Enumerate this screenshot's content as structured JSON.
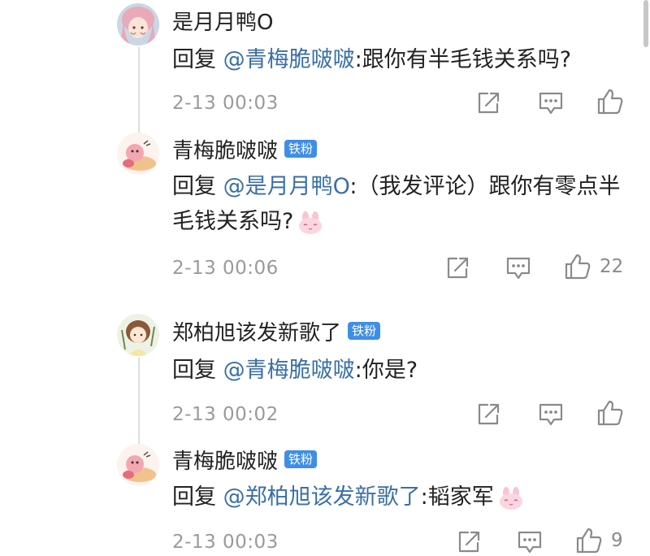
{
  "comments": [
    {
      "username": "是月月鸭O",
      "badge": "",
      "reply_prefix": "回复 ",
      "mention": "@青梅脆啵啵",
      "body": ":跟你有半毛钱关系吗?",
      "time": "2-13 00:03",
      "likes": ""
    },
    {
      "username": "青梅脆啵啵",
      "badge": "铁粉",
      "reply_prefix": "回复 ",
      "mention": "@是月月鸭O",
      "body": ":（我发评论）跟你有零点半毛钱关系吗?",
      "time": "2-13 00:06",
      "likes": "22"
    },
    {
      "username": "郑柏旭该发新歌了",
      "badge": "铁粉",
      "reply_prefix": "回复 ",
      "mention": "@青梅脆啵啵",
      "body": ":你是?",
      "time": "2-13 00:02",
      "likes": ""
    },
    {
      "username": "青梅脆啵啵",
      "badge": "铁粉",
      "reply_prefix": "回复 ",
      "mention": "@郑柏旭该发新歌了",
      "body": ":韬家军",
      "time": "2-13 00:03",
      "likes": "9"
    }
  ],
  "icons": {
    "share": "share-icon",
    "comment": "comment-icon",
    "like": "thumbs-up-icon",
    "emoji": "bunny-emoji-icon"
  },
  "colors": {
    "mention": "#3a6fa8",
    "badge": "#3f8ee6",
    "timestamp": "#9a9a9a"
  }
}
